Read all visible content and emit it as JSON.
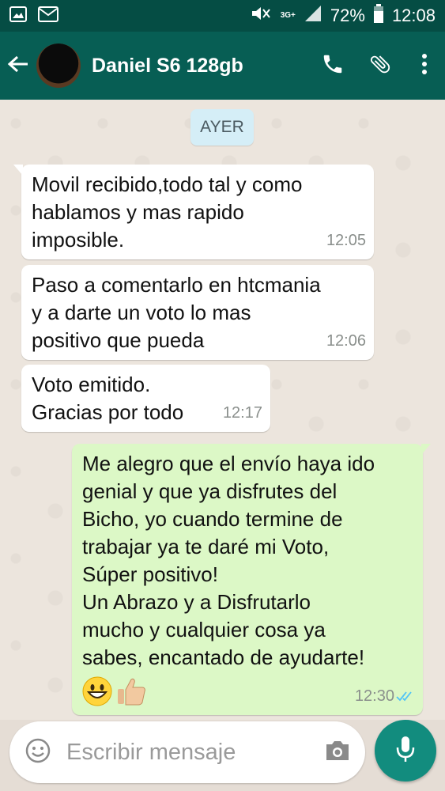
{
  "status_bar": {
    "network": "3G+",
    "battery": "72%",
    "time": "12:08",
    "icons": [
      "image-icon",
      "mail-icon",
      "mute-icon",
      "signal-icon",
      "battery-icon"
    ]
  },
  "header": {
    "contact_name": "Daniel S6 128gb",
    "icons": [
      "back-arrow-icon",
      "phone-icon",
      "attach-icon",
      "more-vert-icon"
    ]
  },
  "chat": {
    "date_chip": "AYER",
    "messages": [
      {
        "direction": "incoming",
        "text": "Movil recibido,todo tal y como\nhablamos y mas rapido\nimposible.",
        "time": "12:05"
      },
      {
        "direction": "incoming",
        "text": "Paso a comentarlo en htcmania\ny a darte un voto lo mas\npositivo que pueda",
        "time": "12:06"
      },
      {
        "direction": "incoming",
        "text": "Voto emitido.\nGracias por todo",
        "time": "12:17"
      },
      {
        "direction": "outgoing",
        "text": "Me alegro que el envío haya ido\ngenial y que ya disfrutes del\nBicho, yo cuando termine de\ntrabajar ya te daré mi Voto,\nSúper positivo!\nUn Abrazo y a Disfrutarlo\nmucho y cualquier cosa ya\nsabes, encantado de ayudarte!",
        "emojis": [
          "grinning-face-emoji",
          "thumbs-up-emoji"
        ],
        "time": "12:30",
        "status": "read"
      }
    ]
  },
  "input": {
    "placeholder": "Escribir mensaje",
    "icons": [
      "emoji-icon",
      "camera-icon",
      "mic-icon"
    ]
  },
  "colors": {
    "status_bar": "#054d44",
    "app_bar": "#075e54",
    "outgoing_bubble": "#dcf8c6",
    "incoming_bubble": "#ffffff",
    "date_chip": "#d5eef7",
    "mic_button": "#128c7e",
    "read_ticks": "#4fc3f7"
  }
}
